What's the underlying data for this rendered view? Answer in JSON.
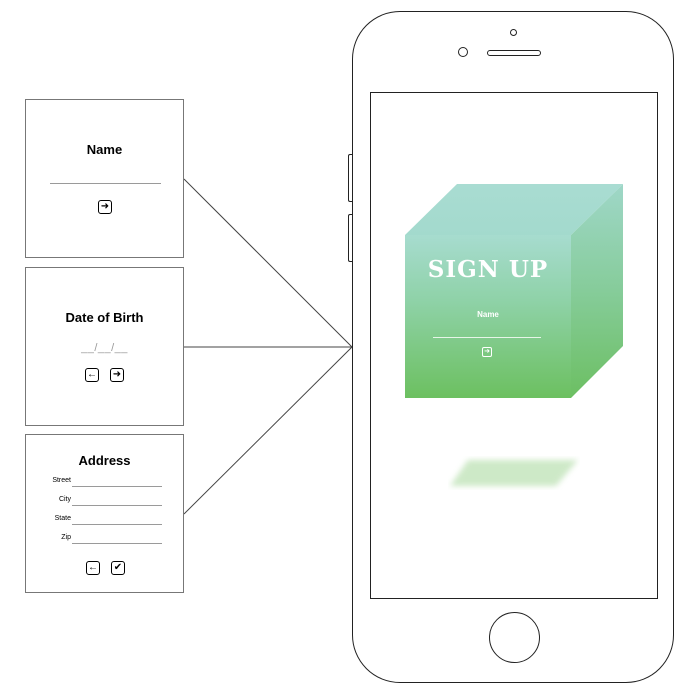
{
  "cards": {
    "name": {
      "title": "Name",
      "next_icon": "➜"
    },
    "dob": {
      "title": "Date of Birth",
      "placeholder": "__/__/__",
      "back_icon": "←",
      "next_icon": "➜"
    },
    "address": {
      "title": "Address",
      "fields": [
        "Street",
        "City",
        "State",
        "Zip"
      ],
      "back_icon": "←",
      "confirm_icon": "✔"
    }
  },
  "phone_screen": {
    "heading": "SIGN UP",
    "field_label": "Name",
    "next_icon": "➜"
  },
  "colors": {
    "cube_top": "#a7dccf",
    "cube_bottom": "#6cc060",
    "outline": "#222222"
  }
}
